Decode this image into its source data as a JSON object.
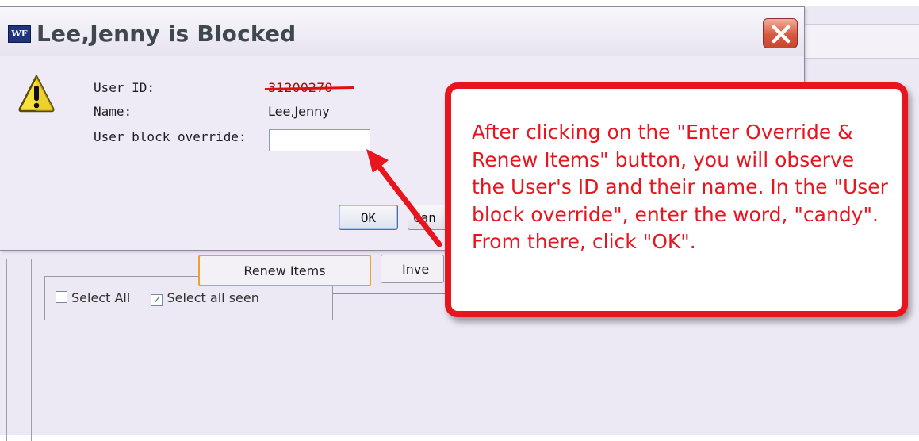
{
  "dialog": {
    "title": "Lee,Jenny is Blocked",
    "app_icon_text": "WF",
    "user_id_label": "User ID:",
    "user_id_value": "31200270",
    "name_label": "Name:",
    "name_value": "Lee,Jenny",
    "override_label": "User block override:",
    "override_value": "",
    "ok_label": "OK",
    "cancel_label": "Can"
  },
  "background": {
    "renew_label": "Renew Items",
    "inve_label": "Inve",
    "select_all_label": "Select All",
    "select_all_seen_label": "Select all seen",
    "select_all_seen_checked": true
  },
  "annotation": {
    "text": "After clicking on the \"Enter Override & Renew Items\" button, you will observe the User's ID and their name.  In the \"User block override\", enter the word, \"candy\".  From there, click \"OK\".",
    "color": "#e8151f"
  },
  "icons": {
    "warning": "warning-icon",
    "close": "close-icon",
    "arrow": "annotation-arrow"
  }
}
